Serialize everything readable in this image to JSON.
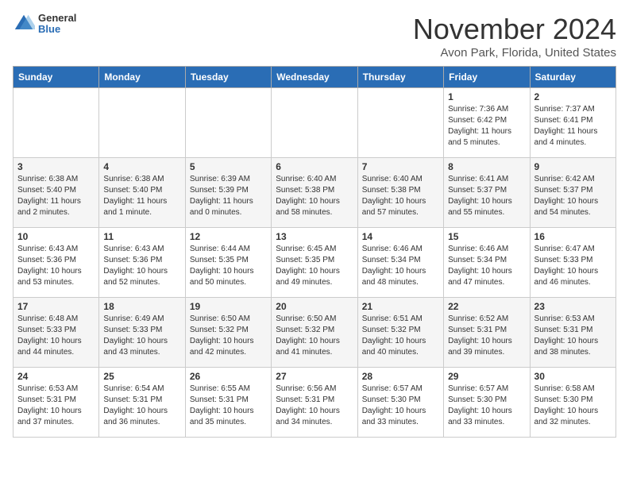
{
  "header": {
    "logo_general": "General",
    "logo_blue": "Blue",
    "month_title": "November 2024",
    "location": "Avon Park, Florida, United States"
  },
  "weekdays": [
    "Sunday",
    "Monday",
    "Tuesday",
    "Wednesday",
    "Thursday",
    "Friday",
    "Saturday"
  ],
  "weeks": [
    [
      {
        "day": "",
        "info": ""
      },
      {
        "day": "",
        "info": ""
      },
      {
        "day": "",
        "info": ""
      },
      {
        "day": "",
        "info": ""
      },
      {
        "day": "",
        "info": ""
      },
      {
        "day": "1",
        "info": "Sunrise: 7:36 AM\nSunset: 6:42 PM\nDaylight: 11 hours\nand 5 minutes."
      },
      {
        "day": "2",
        "info": "Sunrise: 7:37 AM\nSunset: 6:41 PM\nDaylight: 11 hours\nand 4 minutes."
      }
    ],
    [
      {
        "day": "3",
        "info": "Sunrise: 6:38 AM\nSunset: 5:40 PM\nDaylight: 11 hours\nand 2 minutes."
      },
      {
        "day": "4",
        "info": "Sunrise: 6:38 AM\nSunset: 5:40 PM\nDaylight: 11 hours\nand 1 minute."
      },
      {
        "day": "5",
        "info": "Sunrise: 6:39 AM\nSunset: 5:39 PM\nDaylight: 11 hours\nand 0 minutes."
      },
      {
        "day": "6",
        "info": "Sunrise: 6:40 AM\nSunset: 5:38 PM\nDaylight: 10 hours\nand 58 minutes."
      },
      {
        "day": "7",
        "info": "Sunrise: 6:40 AM\nSunset: 5:38 PM\nDaylight: 10 hours\nand 57 minutes."
      },
      {
        "day": "8",
        "info": "Sunrise: 6:41 AM\nSunset: 5:37 PM\nDaylight: 10 hours\nand 55 minutes."
      },
      {
        "day": "9",
        "info": "Sunrise: 6:42 AM\nSunset: 5:37 PM\nDaylight: 10 hours\nand 54 minutes."
      }
    ],
    [
      {
        "day": "10",
        "info": "Sunrise: 6:43 AM\nSunset: 5:36 PM\nDaylight: 10 hours\nand 53 minutes."
      },
      {
        "day": "11",
        "info": "Sunrise: 6:43 AM\nSunset: 5:36 PM\nDaylight: 10 hours\nand 52 minutes."
      },
      {
        "day": "12",
        "info": "Sunrise: 6:44 AM\nSunset: 5:35 PM\nDaylight: 10 hours\nand 50 minutes."
      },
      {
        "day": "13",
        "info": "Sunrise: 6:45 AM\nSunset: 5:35 PM\nDaylight: 10 hours\nand 49 minutes."
      },
      {
        "day": "14",
        "info": "Sunrise: 6:46 AM\nSunset: 5:34 PM\nDaylight: 10 hours\nand 48 minutes."
      },
      {
        "day": "15",
        "info": "Sunrise: 6:46 AM\nSunset: 5:34 PM\nDaylight: 10 hours\nand 47 minutes."
      },
      {
        "day": "16",
        "info": "Sunrise: 6:47 AM\nSunset: 5:33 PM\nDaylight: 10 hours\nand 46 minutes."
      }
    ],
    [
      {
        "day": "17",
        "info": "Sunrise: 6:48 AM\nSunset: 5:33 PM\nDaylight: 10 hours\nand 44 minutes."
      },
      {
        "day": "18",
        "info": "Sunrise: 6:49 AM\nSunset: 5:33 PM\nDaylight: 10 hours\nand 43 minutes."
      },
      {
        "day": "19",
        "info": "Sunrise: 6:50 AM\nSunset: 5:32 PM\nDaylight: 10 hours\nand 42 minutes."
      },
      {
        "day": "20",
        "info": "Sunrise: 6:50 AM\nSunset: 5:32 PM\nDaylight: 10 hours\nand 41 minutes."
      },
      {
        "day": "21",
        "info": "Sunrise: 6:51 AM\nSunset: 5:32 PM\nDaylight: 10 hours\nand 40 minutes."
      },
      {
        "day": "22",
        "info": "Sunrise: 6:52 AM\nSunset: 5:31 PM\nDaylight: 10 hours\nand 39 minutes."
      },
      {
        "day": "23",
        "info": "Sunrise: 6:53 AM\nSunset: 5:31 PM\nDaylight: 10 hours\nand 38 minutes."
      }
    ],
    [
      {
        "day": "24",
        "info": "Sunrise: 6:53 AM\nSunset: 5:31 PM\nDaylight: 10 hours\nand 37 minutes."
      },
      {
        "day": "25",
        "info": "Sunrise: 6:54 AM\nSunset: 5:31 PM\nDaylight: 10 hours\nand 36 minutes."
      },
      {
        "day": "26",
        "info": "Sunrise: 6:55 AM\nSunset: 5:31 PM\nDaylight: 10 hours\nand 35 minutes."
      },
      {
        "day": "27",
        "info": "Sunrise: 6:56 AM\nSunset: 5:31 PM\nDaylight: 10 hours\nand 34 minutes."
      },
      {
        "day": "28",
        "info": "Sunrise: 6:57 AM\nSunset: 5:30 PM\nDaylight: 10 hours\nand 33 minutes."
      },
      {
        "day": "29",
        "info": "Sunrise: 6:57 AM\nSunset: 5:30 PM\nDaylight: 10 hours\nand 33 minutes."
      },
      {
        "day": "30",
        "info": "Sunrise: 6:58 AM\nSunset: 5:30 PM\nDaylight: 10 hours\nand 32 minutes."
      }
    ]
  ]
}
